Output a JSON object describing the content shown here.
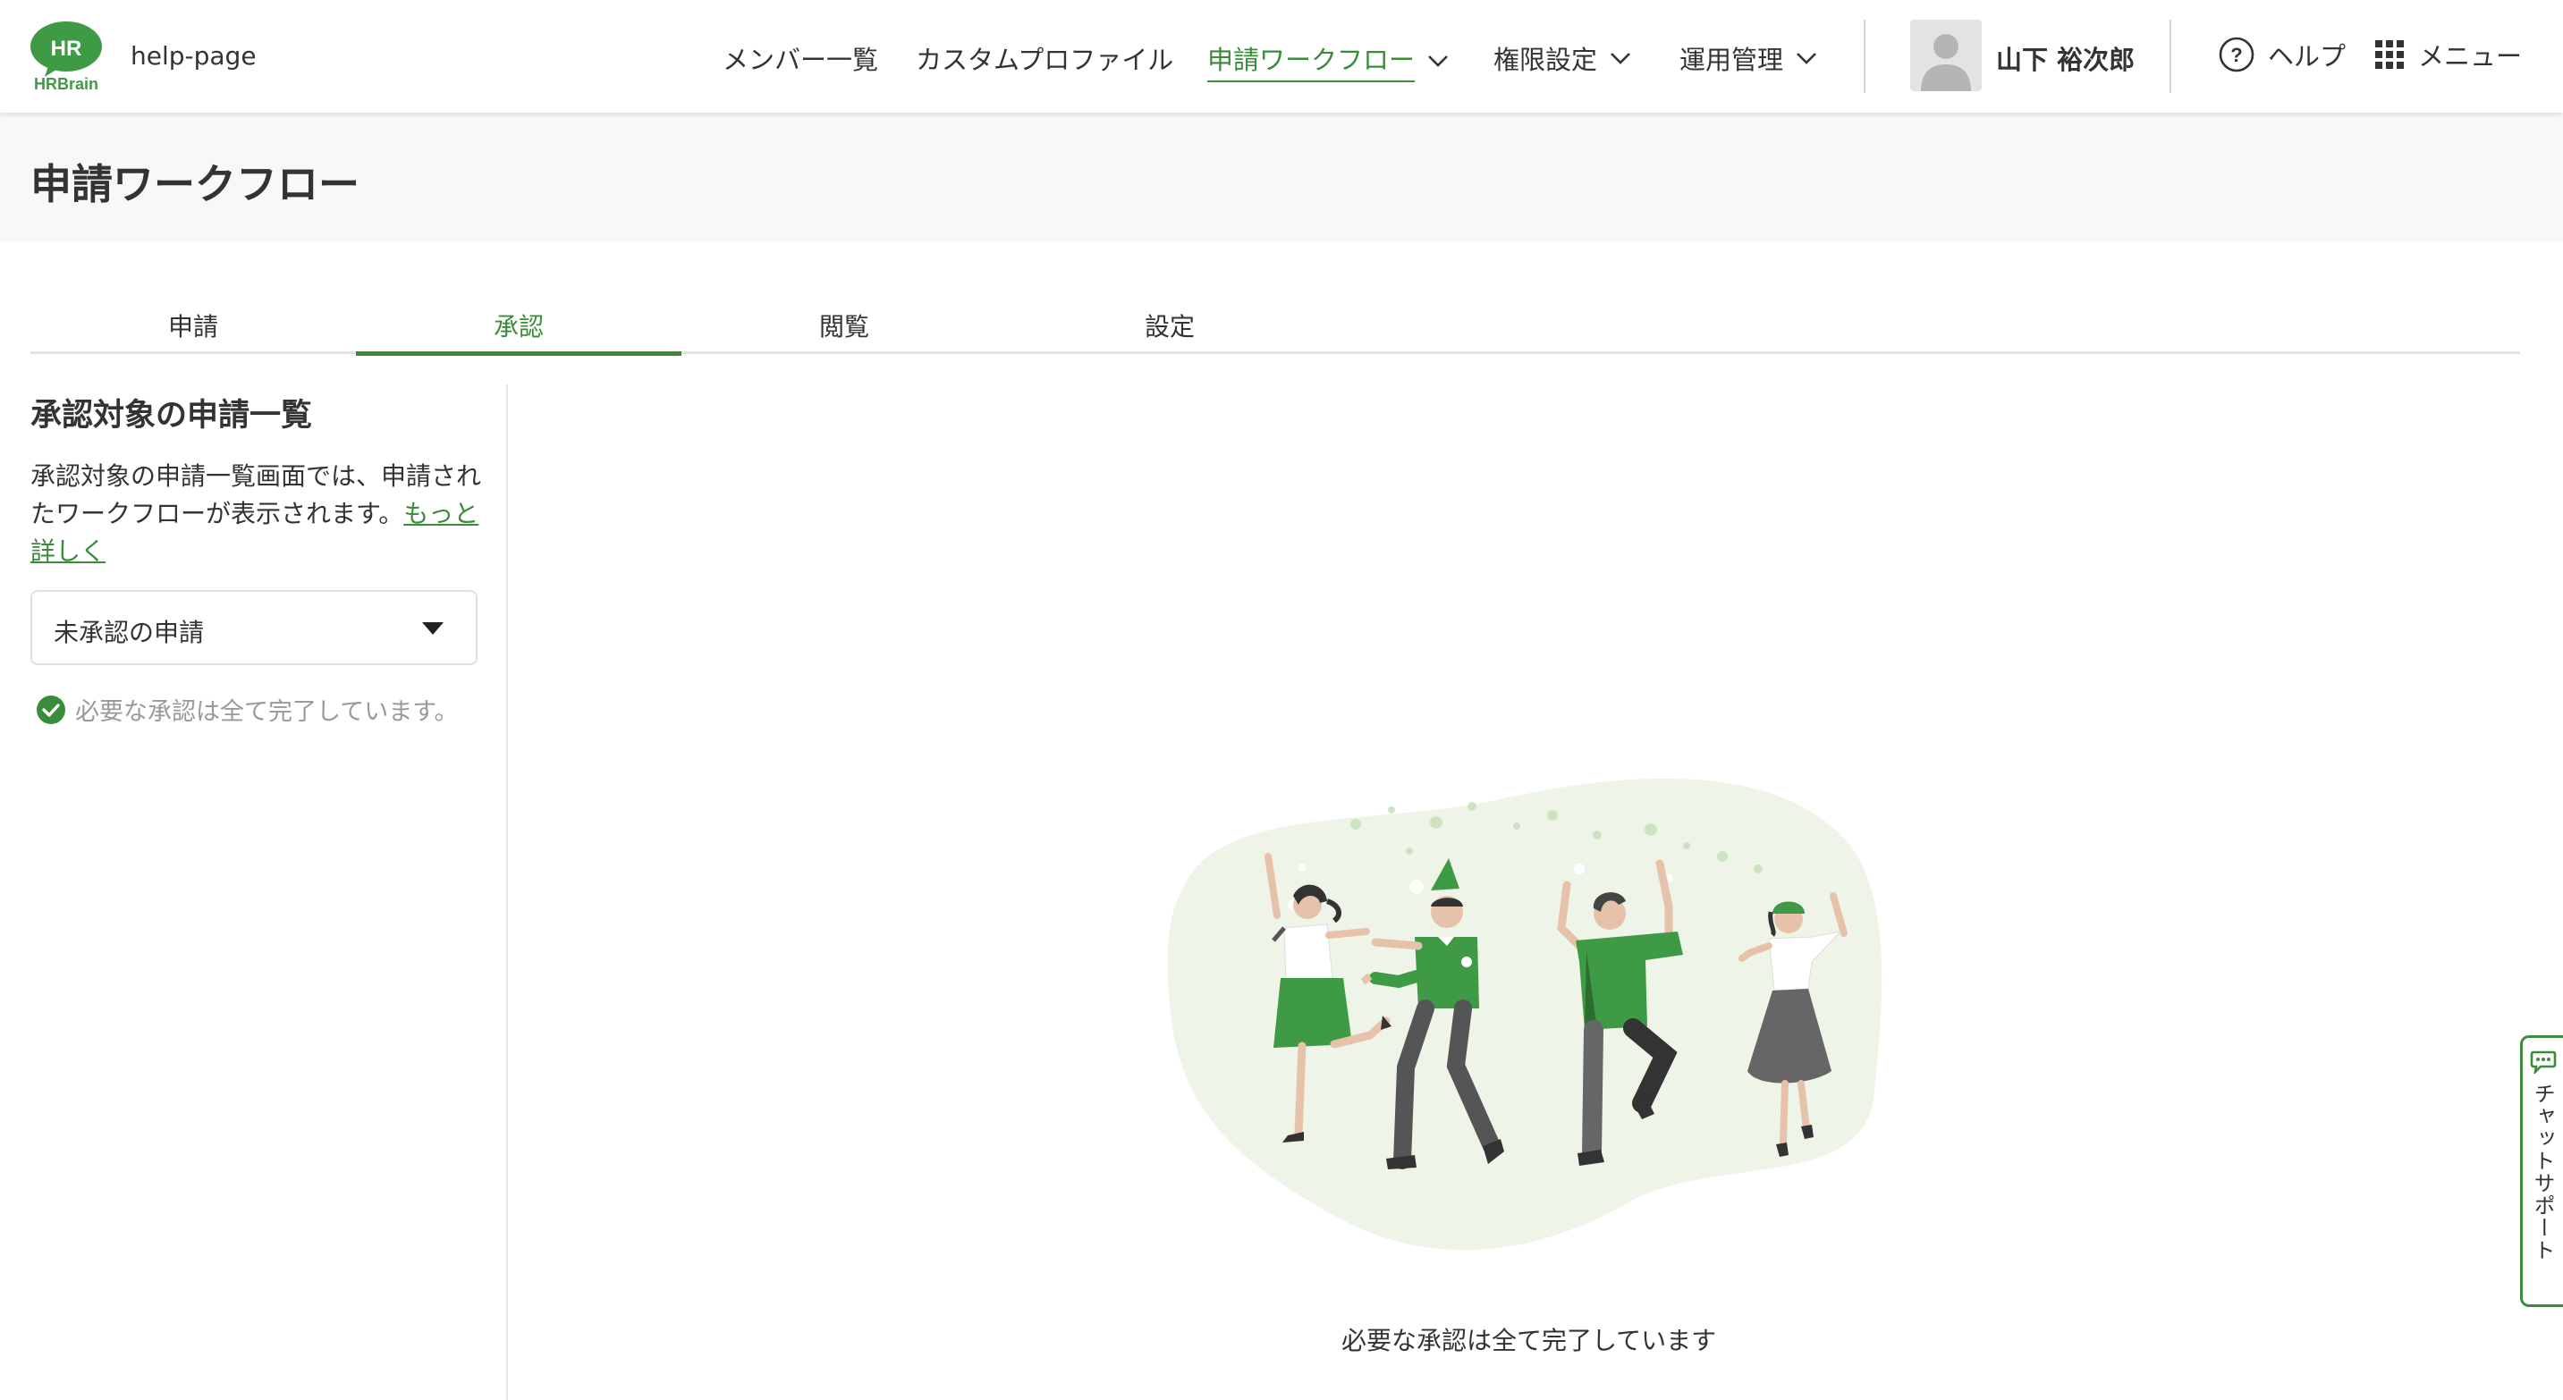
{
  "header": {
    "logo_text": "HR",
    "logo_brand": "HRBrain",
    "app_name": "help-page",
    "nav": [
      {
        "label": "メンバー一覧"
      },
      {
        "label": "カスタムプロファイル"
      },
      {
        "label": "申請ワークフロー"
      },
      {
        "label": "権限設定"
      },
      {
        "label": "運用管理"
      }
    ],
    "user_name": "山下 裕次郎",
    "help_label": "ヘルプ",
    "menu_label": "メニュー"
  },
  "page": {
    "title": "申請ワークフロー"
  },
  "tabs": [
    {
      "label": "申請"
    },
    {
      "label": "承認"
    },
    {
      "label": "閲覧"
    },
    {
      "label": "設定"
    }
  ],
  "side": {
    "title": "承認対象の申請一覧",
    "description": "承認対象の申請一覧画面では、申請されたワークフローが表示されます。",
    "more_link": "もっと詳しく",
    "filter_value": "未承認の申請",
    "status_text": "必要な承認は全て完了しています。"
  },
  "main": {
    "empty_message": "必要な承認は全て完了しています"
  },
  "chat_support": {
    "label": "チャットサポート"
  },
  "colors": {
    "accent": "#3a8b3a",
    "muted_text": "#999999",
    "title_band": "#f8f8f8"
  }
}
